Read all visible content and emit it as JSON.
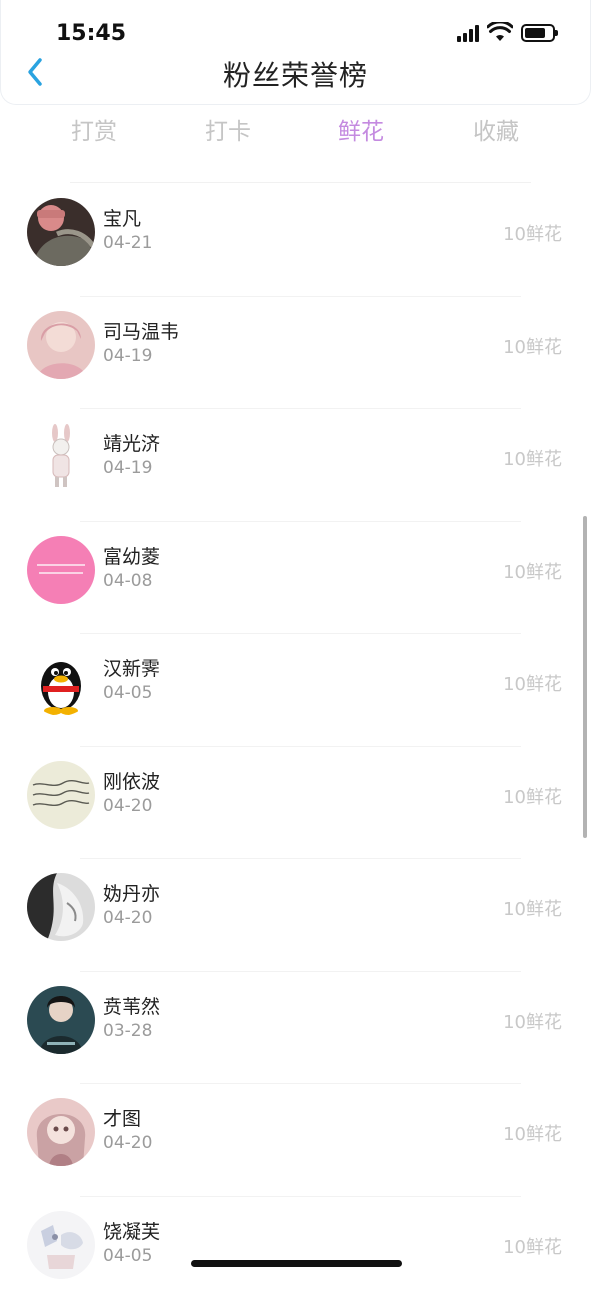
{
  "status_bar": {
    "time": "15:45"
  },
  "header": {
    "title": "粉丝荣誉榜"
  },
  "tabs": [
    {
      "label": "打赏"
    },
    {
      "label": "打卡"
    },
    {
      "label": "鲜花",
      "active": true
    },
    {
      "label": "收藏"
    }
  ],
  "colors": {
    "active_tab": "#c48ae0",
    "muted": "#c8c8c8"
  },
  "fans": [
    {
      "name": "宝凡",
      "date": "04-21",
      "amount": "10鲜花",
      "avatar": "photo-dark-cap"
    },
    {
      "name": "司马温韦",
      "date": "04-19",
      "amount": "10鲜花",
      "avatar": "photo-pink-girl"
    },
    {
      "name": "靖光济",
      "date": "04-19",
      "amount": "10鲜花",
      "avatar": "illustration-bunny"
    },
    {
      "name": "富幼菱",
      "date": "04-08",
      "amount": "10鲜花",
      "avatar": "pink-text-card"
    },
    {
      "name": "汉新霁",
      "date": "04-05",
      "amount": "10鲜花",
      "avatar": "qq-penguin"
    },
    {
      "name": "刚依波",
      "date": "04-20",
      "amount": "10鲜花",
      "avatar": "handwriting-note"
    },
    {
      "name": "妫丹亦",
      "date": "04-20",
      "amount": "10鲜花",
      "avatar": "bw-portrait"
    },
    {
      "name": "贲苇然",
      "date": "03-28",
      "amount": "10鲜花",
      "avatar": "teal-portrait"
    },
    {
      "name": "才图",
      "date": "04-20",
      "amount": "10鲜花",
      "avatar": "doll-portrait"
    },
    {
      "name": "饶凝芙",
      "date": "04-05",
      "amount": "10鲜花",
      "avatar": "sketch-illustration"
    }
  ]
}
